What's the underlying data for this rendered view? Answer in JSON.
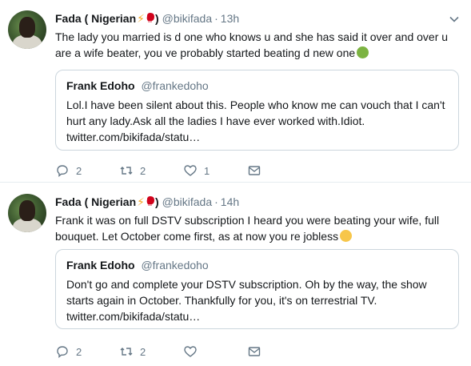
{
  "tweets": [
    {
      "author": {
        "name": "Fada ( Nigerian",
        "name_suffix": ")",
        "handle": "@bikifada",
        "time": "13h",
        "emojis": [
          "lightning-bolt",
          "boxing-glove"
        ]
      },
      "text": "The lady you married is d one who knows u and she has said it over and over u are a wife beater, you ve probably started beating d new one",
      "text_emoji": "nauseated-face",
      "quoted": {
        "name": "Frank Edoho",
        "handle": "@frankedoho",
        "text": "Lol.I have been silent about this. People who know me can vouch that I can't hurt any lady.Ask all the ladies I have ever worked with.Idiot.",
        "link": "twitter.com/bikifada/statu…"
      },
      "actions": {
        "replies": "2",
        "retweets": "2",
        "likes": "1"
      }
    },
    {
      "author": {
        "name": "Fada ( Nigerian",
        "name_suffix": ")",
        "handle": "@bikifada",
        "time": "14h",
        "emojis": [
          "lightning-bolt",
          "boxing-glove"
        ]
      },
      "text": "Frank it was on full DSTV subscription I heard you were beating your wife, full bouquet. Let October come first, as at now you re jobless",
      "text_emoji": "face-blowing-kiss",
      "quoted": {
        "name": "Frank Edoho",
        "handle": "@frankedoho",
        "text": "Don't go and complete your DSTV subscription. Oh by the way, the show starts again in October. Thankfully for you, it's on terrestrial TV.",
        "link": "twitter.com/bikifada/statu…"
      },
      "actions": {
        "replies": "2",
        "retweets": "2",
        "likes": ""
      }
    }
  ],
  "separator": "·",
  "colors": {
    "text": "#14171a",
    "secondary": "#657786",
    "border": "#ccd6dd",
    "divider": "#e6ecf0"
  }
}
